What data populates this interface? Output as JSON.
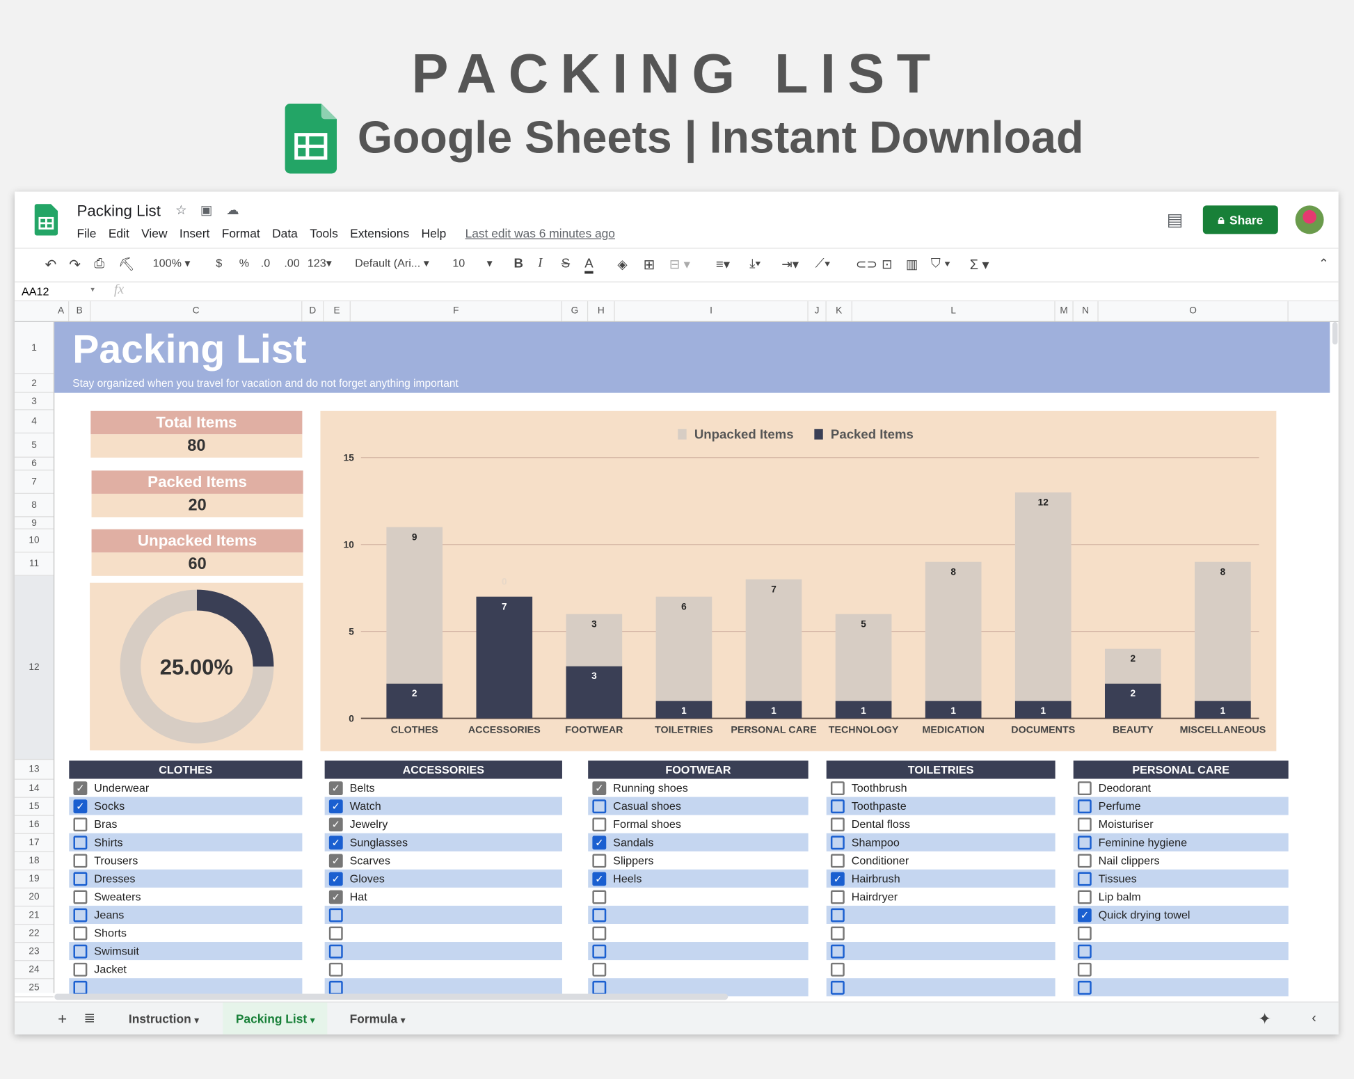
{
  "promo": {
    "title": "PACKING LIST",
    "subtitle": "Google Sheets | Instant Download"
  },
  "app": {
    "doc_title": "Packing List",
    "menu": [
      "File",
      "Edit",
      "View",
      "Insert",
      "Format",
      "Data",
      "Tools",
      "Extensions",
      "Help"
    ],
    "last_edit": "Last edit was 6 minutes ago",
    "share_label": "Share",
    "accent": "#188038"
  },
  "toolbar": {
    "zoom": "100%",
    "currency": "$",
    "percent": "%",
    "dec_less": ".0",
    "dec_more": ".00",
    "format": "123",
    "font": "Default (Ari...",
    "font_size": "10"
  },
  "formula_bar": {
    "cell_ref": "AA12",
    "fx": "fx",
    "value": ""
  },
  "columns": [
    "A",
    "B",
    "C",
    "D",
    "E",
    "F",
    "G",
    "H",
    "I",
    "J",
    "K",
    "L",
    "M",
    "N",
    "O"
  ],
  "rows": [
    "1",
    "2",
    "3",
    "4",
    "5",
    "6",
    "7",
    "8",
    "9",
    "10",
    "11",
    "12",
    "13",
    "14",
    "15",
    "16",
    "17",
    "18",
    "19",
    "20",
    "21",
    "22",
    "23",
    "24",
    "25"
  ],
  "sheet": {
    "title": "Packing List",
    "subtitle": "Stay organized when you travel for vacation and do not forget anything important",
    "stats": [
      {
        "label": "Total Items",
        "value": "80"
      },
      {
        "label": "Packed Items",
        "value": "20"
      },
      {
        "label": "Unpacked Items",
        "value": "60"
      }
    ],
    "donut": {
      "label": "25.00%",
      "packed_fraction": 0.25,
      "colors": {
        "packed": "#3a3f55",
        "unpacked": "#d7cdc4"
      }
    }
  },
  "chart_data": {
    "type": "bar",
    "stacked": true,
    "categories": [
      "CLOTHES",
      "ACCESSORIES",
      "FOOTWEAR",
      "TOILETRIES",
      "PERSONAL CARE",
      "TECHNOLOGY",
      "MEDICATION",
      "DOCUMENTS",
      "BEAUTY",
      "MISCELLANEOUS"
    ],
    "series": [
      {
        "name": "Packed Items",
        "color": "#3a3f55",
        "values": [
          2,
          7,
          3,
          1,
          1,
          1,
          1,
          1,
          2,
          1
        ]
      },
      {
        "name": "Unpacked Items",
        "color": "#d7cdc4",
        "values": [
          9,
          0,
          3,
          6,
          7,
          5,
          8,
          12,
          2,
          8
        ]
      }
    ],
    "legend_order": [
      "Unpacked Items",
      "Packed Items"
    ],
    "legend_position": "top",
    "ylim": [
      0,
      15
    ],
    "yticks": [
      0,
      5,
      10,
      15
    ],
    "grid": true
  },
  "lists": [
    {
      "title": "CLOTHES",
      "items": [
        {
          "label": "Underwear",
          "checked": true
        },
        {
          "label": "Socks",
          "checked": true
        },
        {
          "label": "Bras",
          "checked": false
        },
        {
          "label": "Shirts",
          "checked": false
        },
        {
          "label": "Trousers",
          "checked": false
        },
        {
          "label": "Dresses",
          "checked": false
        },
        {
          "label": "Sweaters",
          "checked": false
        },
        {
          "label": "Jeans",
          "checked": false
        },
        {
          "label": "Shorts",
          "checked": false
        },
        {
          "label": "Swimsuit",
          "checked": false
        },
        {
          "label": "Jacket",
          "checked": false
        },
        {
          "label": "",
          "checked": false
        }
      ]
    },
    {
      "title": "ACCESSORIES",
      "items": [
        {
          "label": "Belts",
          "checked": true
        },
        {
          "label": "Watch",
          "checked": true
        },
        {
          "label": "Jewelry",
          "checked": true
        },
        {
          "label": "Sunglasses",
          "checked": true
        },
        {
          "label": "Scarves",
          "checked": true
        },
        {
          "label": "Gloves",
          "checked": true
        },
        {
          "label": "Hat",
          "checked": true
        },
        {
          "label": "",
          "checked": false
        },
        {
          "label": "",
          "checked": false
        },
        {
          "label": "",
          "checked": false
        },
        {
          "label": "",
          "checked": false
        },
        {
          "label": "",
          "checked": false
        }
      ]
    },
    {
      "title": "FOOTWEAR",
      "items": [
        {
          "label": "Running shoes",
          "checked": true
        },
        {
          "label": "Casual shoes",
          "checked": false
        },
        {
          "label": "Formal shoes",
          "checked": false
        },
        {
          "label": "Sandals",
          "checked": true
        },
        {
          "label": "Slippers",
          "checked": false
        },
        {
          "label": "Heels",
          "checked": true
        },
        {
          "label": "",
          "checked": false
        },
        {
          "label": "",
          "checked": false
        },
        {
          "label": "",
          "checked": false
        },
        {
          "label": "",
          "checked": false
        },
        {
          "label": "",
          "checked": false
        },
        {
          "label": "",
          "checked": false
        }
      ]
    },
    {
      "title": "TOILETRIES",
      "items": [
        {
          "label": "Toothbrush",
          "checked": false
        },
        {
          "label": "Toothpaste",
          "checked": false
        },
        {
          "label": "Dental floss",
          "checked": false
        },
        {
          "label": "Shampoo",
          "checked": false
        },
        {
          "label": "Conditioner",
          "checked": false
        },
        {
          "label": "Hairbrush",
          "checked": true
        },
        {
          "label": "Hairdryer",
          "checked": false
        },
        {
          "label": "",
          "checked": false
        },
        {
          "label": "",
          "checked": false
        },
        {
          "label": "",
          "checked": false
        },
        {
          "label": "",
          "checked": false
        },
        {
          "label": "",
          "checked": false
        }
      ]
    },
    {
      "title": "PERSONAL CARE",
      "items": [
        {
          "label": "Deodorant",
          "checked": false
        },
        {
          "label": "Perfume",
          "checked": false
        },
        {
          "label": "Moisturiser",
          "checked": false
        },
        {
          "label": "Feminine hygiene",
          "checked": false
        },
        {
          "label": "Nail clippers",
          "checked": false
        },
        {
          "label": "Tissues",
          "checked": false
        },
        {
          "label": "Lip balm",
          "checked": false
        },
        {
          "label": "Quick drying towel",
          "checked": true
        },
        {
          "label": "",
          "checked": false
        },
        {
          "label": "",
          "checked": false
        },
        {
          "label": "",
          "checked": false
        },
        {
          "label": "",
          "checked": false
        }
      ]
    }
  ],
  "sheet_tabs": [
    {
      "label": "Instruction",
      "active": false
    },
    {
      "label": "Packing List",
      "active": true
    },
    {
      "label": "Formula",
      "active": false
    }
  ]
}
